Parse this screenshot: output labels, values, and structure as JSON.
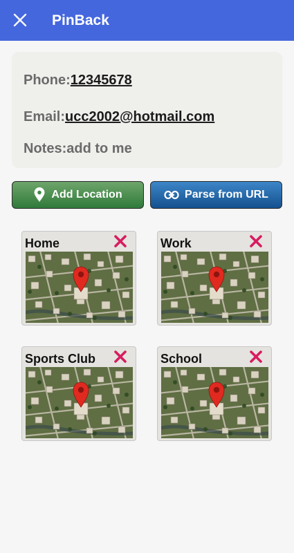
{
  "app": {
    "title": "PinBack",
    "close_icon": "close-icon"
  },
  "contact": {
    "phone_label": "Phone:",
    "phone_value": "12345678",
    "email_label": "Email:",
    "email_value": "ucc2002@hotmail.com",
    "notes_label": "Notes:",
    "notes_value": "add to me"
  },
  "actions": {
    "add_location_label": "Add Location",
    "add_location_icon": "map-pin-icon",
    "parse_url_label": "Parse from URL",
    "parse_url_icon": "link-icon"
  },
  "locations": [
    {
      "name": "Home"
    },
    {
      "name": "Work"
    },
    {
      "name": "Sports Club"
    },
    {
      "name": "School"
    }
  ],
  "colors": {
    "appbar": "#4567dd",
    "remove": "#d81b60",
    "pin": "#e02a20",
    "add_button": "#3f8a45",
    "parse_button": "#1f63a8"
  }
}
